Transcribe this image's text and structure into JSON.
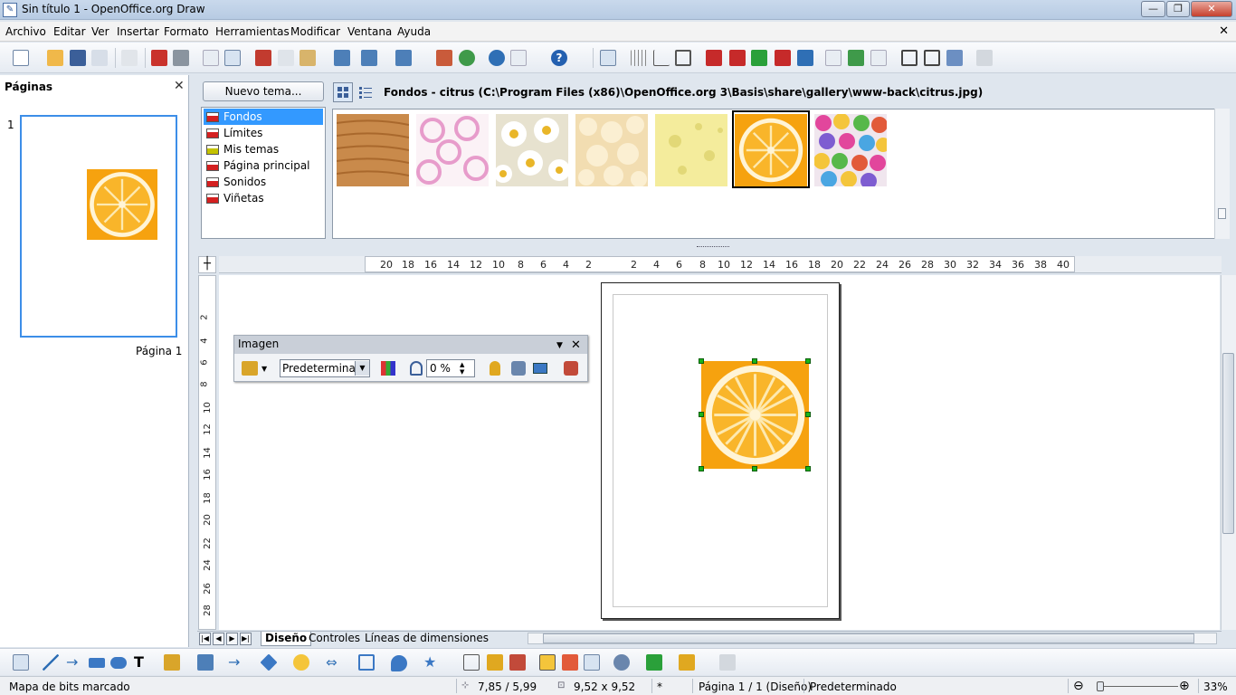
{
  "window": {
    "title": "Sin título 1 - OpenOffice.org Draw",
    "minimize": "—",
    "maximize": "❐",
    "close": "✕",
    "doc_close": "✕"
  },
  "menus": [
    "Archivo",
    "Editar",
    "Ver",
    "Insertar",
    "Formato",
    "Herramientas",
    "Modificar",
    "Ventana",
    "Ayuda"
  ],
  "pages_panel": {
    "title": "Páginas",
    "close": "✕",
    "page_number": "1",
    "page_label": "Página 1"
  },
  "gallery": {
    "new_theme": "Nuevo tema...",
    "path": "Fondos - citrus (C:\\Program Files (x86)\\OpenOffice.org 3\\Basis\\share\\gallery\\www-back\\citrus.jpg)",
    "themes": [
      "Fondos",
      "Límites",
      "Mis temas",
      "Página principal",
      "Sonidos",
      "Viñetas"
    ],
    "selected_theme": "Fondos",
    "thumbnails": [
      "wood",
      "rings",
      "daisies",
      "popcorn",
      "cheese",
      "citrus",
      "candy"
    ],
    "selected_thumbnail": "citrus"
  },
  "ruler_h": [
    "20",
    "18",
    "16",
    "14",
    "12",
    "10",
    "8",
    "6",
    "4",
    "2",
    "2",
    "4",
    "6",
    "8",
    "10",
    "12",
    "14",
    "16",
    "18",
    "20",
    "22",
    "24",
    "26",
    "28",
    "30",
    "32",
    "34",
    "36",
    "38",
    "40"
  ],
  "ruler_v": [
    "2",
    "4",
    "6",
    "8",
    "10",
    "12",
    "14",
    "16",
    "18",
    "20",
    "22",
    "24",
    "26",
    "28"
  ],
  "image_toolbar": {
    "title": "Imagen",
    "menu": "▼",
    "close": "✕",
    "mode": "Predeterminado",
    "transparency": "0 %"
  },
  "tabs": [
    "Diseño",
    "Controles",
    "Líneas de dimensiones"
  ],
  "status": {
    "message": "Mapa de bits marcado",
    "position": "7,85 / 5,99",
    "size": "9,52 x 9,52",
    "modified": "*",
    "page": "Página 1 / 1 (Diseño)",
    "style": "Predeterminado",
    "zoom": "33%"
  },
  "colors": {
    "accent": "#3399ff",
    "selection_handle": "#1ab51a",
    "orange": "#f7a81b"
  }
}
